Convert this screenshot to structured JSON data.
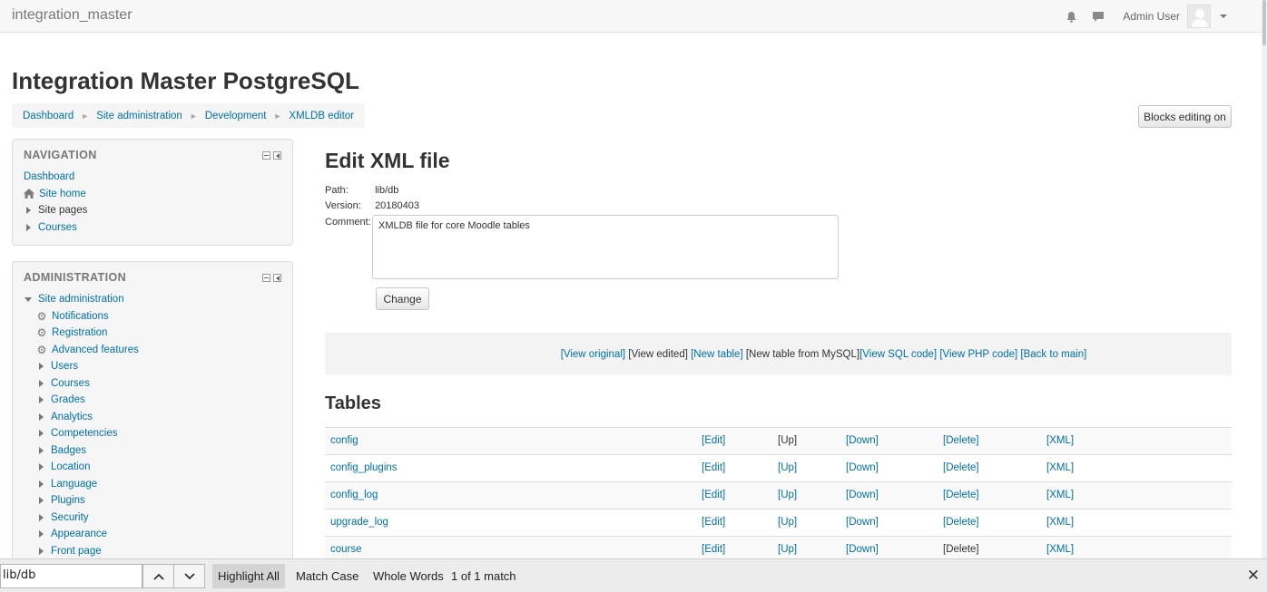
{
  "navbar": {
    "brand": "integration_master",
    "user_name": "Admin User",
    "icons": [
      "bell-icon",
      "message-icon"
    ]
  },
  "header": {
    "title": "Integration Master PostgreSQL",
    "breadcrumb": [
      "Dashboard",
      "Site administration",
      "Development",
      "XMLDB editor"
    ],
    "breadcrumb_separator": "►",
    "blocks_editing_label": "Blocks editing on"
  },
  "navigation_block": {
    "title": "NAVIGATION",
    "items": [
      {
        "label": "Dashboard",
        "type": "link"
      },
      {
        "label": "Site home",
        "type": "home"
      },
      {
        "label": "Site pages",
        "type": "collapsed-plain"
      },
      {
        "label": "Courses",
        "type": "collapsed"
      }
    ]
  },
  "admin_block": {
    "title": "ADMINISTRATION",
    "root": "Site administration",
    "items": [
      {
        "label": "Notifications",
        "type": "gear"
      },
      {
        "label": "Registration",
        "type": "gear"
      },
      {
        "label": "Advanced features",
        "type": "gear"
      },
      {
        "label": "Users",
        "type": "collapsed"
      },
      {
        "label": "Courses",
        "type": "collapsed"
      },
      {
        "label": "Grades",
        "type": "collapsed"
      },
      {
        "label": "Analytics",
        "type": "collapsed"
      },
      {
        "label": "Competencies",
        "type": "collapsed"
      },
      {
        "label": "Badges",
        "type": "collapsed"
      },
      {
        "label": "Location",
        "type": "collapsed"
      },
      {
        "label": "Language",
        "type": "collapsed"
      },
      {
        "label": "Plugins",
        "type": "collapsed"
      },
      {
        "label": "Security",
        "type": "collapsed"
      },
      {
        "label": "Appearance",
        "type": "collapsed"
      },
      {
        "label": "Front page",
        "type": "collapsed"
      }
    ]
  },
  "main": {
    "heading": "Edit XML file",
    "path_label": "Path:",
    "path_value": "lib/db",
    "version_label": "Version:",
    "version_value": "20180403",
    "comment_label": "Comment:",
    "comment_value": "XMLDB file for core Moodle tables",
    "change_label": "Change",
    "actions": [
      {
        "label": "[View original]",
        "link": true
      },
      {
        "label": " [View edited] ",
        "link": false
      },
      {
        "label": "[New table]",
        "link": true
      },
      {
        "label": " [New table from MySQL]",
        "link": false
      },
      {
        "label": "[View SQL code]",
        "link": true
      },
      {
        "label": " ",
        "link": false
      },
      {
        "label": "[View PHP code]",
        "link": true
      },
      {
        "label": " ",
        "link": false
      },
      {
        "label": "[Back to main]",
        "link": true
      }
    ],
    "tables_heading": "Tables",
    "tables": [
      {
        "name": "config",
        "edit": "[Edit]",
        "up": "[Up]",
        "up_link": false,
        "down": "[Down]",
        "delete": "[Delete]",
        "delete_link": true,
        "xml": "[XML]"
      },
      {
        "name": "config_plugins",
        "edit": "[Edit]",
        "up": "[Up]",
        "up_link": true,
        "down": "[Down]",
        "delete": "[Delete]",
        "delete_link": true,
        "xml": "[XML]"
      },
      {
        "name": "config_log",
        "edit": "[Edit]",
        "up": "[Up]",
        "up_link": true,
        "down": "[Down]",
        "delete": "[Delete]",
        "delete_link": true,
        "xml": "[XML]"
      },
      {
        "name": "upgrade_log",
        "edit": "[Edit]",
        "up": "[Up]",
        "up_link": true,
        "down": "[Down]",
        "delete": "[Delete]",
        "delete_link": true,
        "xml": "[XML]"
      },
      {
        "name": "course",
        "edit": "[Edit]",
        "up": "[Up]",
        "up_link": true,
        "down": "[Down]",
        "delete": "[Delete]",
        "delete_link": false,
        "xml": "[XML]"
      }
    ]
  },
  "findbar": {
    "query": "lib/db",
    "prev_icon": "chevron-up-icon",
    "next_icon": "chevron-down-icon",
    "highlight_all": "Highlight All",
    "match_case": "Match Case",
    "whole_words": "Whole Words",
    "status": "1 of 1 match",
    "close_icon": "close-icon"
  }
}
